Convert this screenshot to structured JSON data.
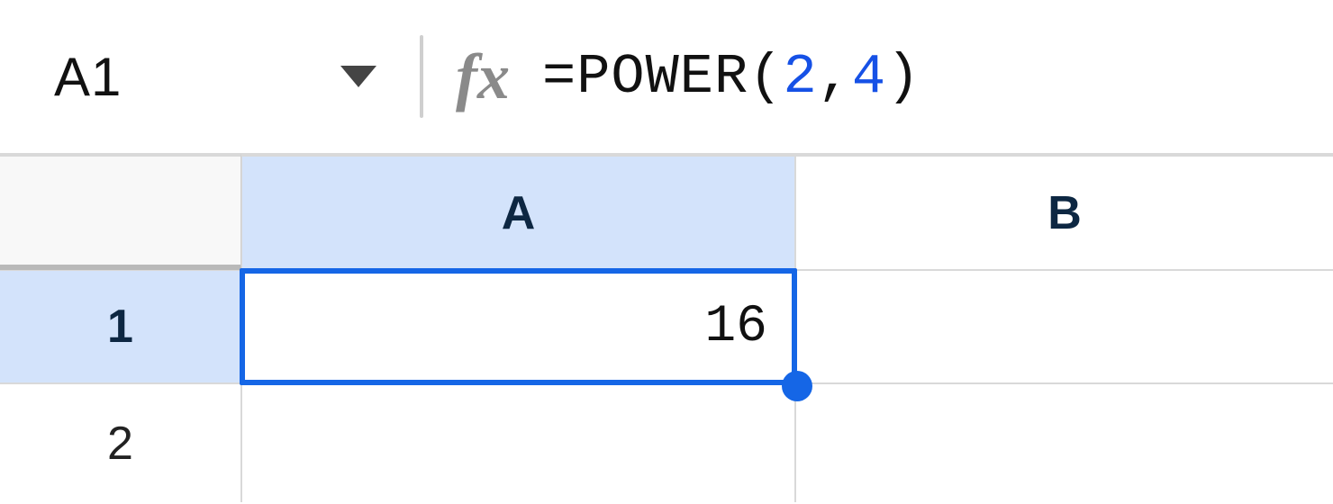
{
  "nameBox": {
    "value": "A1"
  },
  "fx": {
    "label": "fx"
  },
  "formula": {
    "prefix": "=POWER(",
    "arg1": "2",
    "sep": ",",
    "arg2": "4",
    "suffix": ")"
  },
  "columns": [
    "A",
    "B"
  ],
  "rows": [
    "1",
    "2"
  ],
  "selection": {
    "col": "A",
    "row": "1",
    "cellRef": "A1"
  },
  "cells": {
    "A1": "16",
    "B1": "",
    "A2": "",
    "B2": ""
  },
  "colors": {
    "selectionBorder": "#1566e6",
    "headerSelected": "#d3e3fb",
    "formulaNumber": "#1651e6"
  }
}
